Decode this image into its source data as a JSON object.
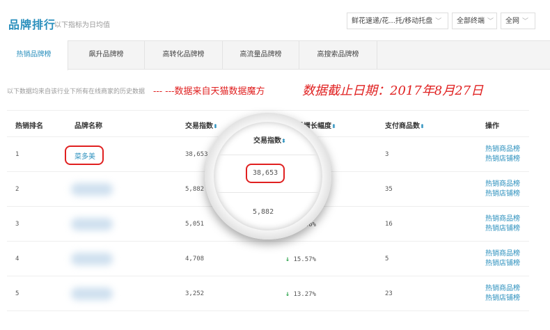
{
  "header": {
    "title": "品牌排行",
    "subtitle": "以下指标为日均值",
    "category_select": "鲜花速递/花...托/移动托盘",
    "terminal_select": "全部终端",
    "scope_select": "全网"
  },
  "tabs": [
    {
      "label": "热销品牌榜",
      "active": true
    },
    {
      "label": "飙升品牌榜",
      "active": false
    },
    {
      "label": "高转化品牌榜",
      "active": false
    },
    {
      "label": "高流量品牌榜",
      "active": false
    },
    {
      "label": "高搜索品牌榜",
      "active": false
    }
  ],
  "notes": {
    "description": "以下数据均来自该行业下所有在线商家的历史数据",
    "source": "--- ---数据来自天猫数据魔方",
    "cutoff": "数据截止日期：2017年8月27日"
  },
  "table": {
    "columns": [
      "热销排名",
      "品牌名称",
      "交易指数",
      "交易增长幅度",
      "支付商品数",
      "操作"
    ],
    "rows": [
      {
        "rank": "1",
        "brand": "菜多美",
        "trade_index": "38,653",
        "growth": "",
        "pay_items": "3",
        "op1": "热销商品榜",
        "op2": "热销店铺榜"
      },
      {
        "rank": "2",
        "brand": "",
        "trade_index": "5,882",
        "growth": "",
        "pay_items": "35",
        "op1": "热销商品榜",
        "op2": "热销店铺榜"
      },
      {
        "rank": "3",
        "brand": "",
        "trade_index": "5,051",
        "growth": "13.46%",
        "pay_items": "16",
        "op1": "热销商品榜",
        "op2": "热销店铺榜"
      },
      {
        "rank": "4",
        "brand": "",
        "trade_index": "4,708",
        "growth": "15.57%",
        "pay_items": "5",
        "op1": "热销商品榜",
        "op2": "热销店铺榜"
      },
      {
        "rank": "5",
        "brand": "",
        "trade_index": "3,252",
        "growth": "13.27%",
        "pay_items": "23",
        "op1": "热销商品榜",
        "op2": "热销店铺榜"
      }
    ]
  },
  "magnifier": {
    "header": "交易指数",
    "value1": "38,653",
    "value2": "5,882"
  },
  "colors": {
    "accent": "#2a8fbd",
    "highlight": "#e02020",
    "growth_up": "#2aa34a"
  },
  "icons": {
    "sort": "sort-icon",
    "chevron": "chevron-down-icon",
    "up_arrow": "arrow-up-icon"
  }
}
